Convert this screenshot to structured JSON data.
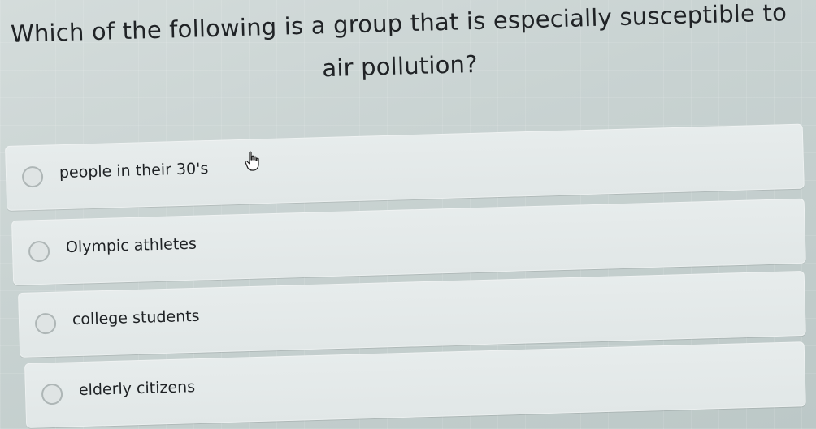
{
  "question": {
    "line1": "Which of the following is a group that is especially susceptible to",
    "line2": "air pollution?"
  },
  "options": [
    {
      "label": "people in their 30's"
    },
    {
      "label": "Olympic athletes"
    },
    {
      "label": "college students"
    },
    {
      "label": "elderly citizens"
    }
  ],
  "cursor": {
    "icon": "hand-pointer-icon"
  }
}
